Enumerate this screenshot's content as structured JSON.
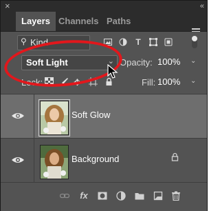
{
  "panel": {
    "close_glyph": "×",
    "collapse_glyph": "«",
    "tabs": [
      {
        "label": "Layers",
        "active": true
      },
      {
        "label": "Channels",
        "active": false
      },
      {
        "label": "Paths",
        "active": false
      }
    ]
  },
  "filter": {
    "kind_label": "Kind",
    "icons": [
      "image-filter-icon",
      "adjustment-filter-icon",
      "type-filter-icon",
      "shape-filter-icon",
      "smart-object-filter-icon"
    ]
  },
  "blend": {
    "mode": "Soft Light",
    "opacity_label": "Opacity:",
    "opacity_value": "100%"
  },
  "lock": {
    "label": "Lock:",
    "fill_label": "Fill:",
    "fill_value": "100%"
  },
  "layers": [
    {
      "name": "Soft Glow",
      "visible": true,
      "selected": true,
      "locked": false
    },
    {
      "name": "Background",
      "visible": true,
      "selected": false,
      "locked": true
    }
  ],
  "footer_icons": [
    "link-icon",
    "fx-icon",
    "mask-icon",
    "adjustment-layer-icon",
    "group-folder-icon",
    "new-layer-icon",
    "trash-icon"
  ],
  "colors": {
    "annotation_red": "#e2171c",
    "panel_bg": "#535353",
    "selected_row": "#6e6e6e"
  }
}
